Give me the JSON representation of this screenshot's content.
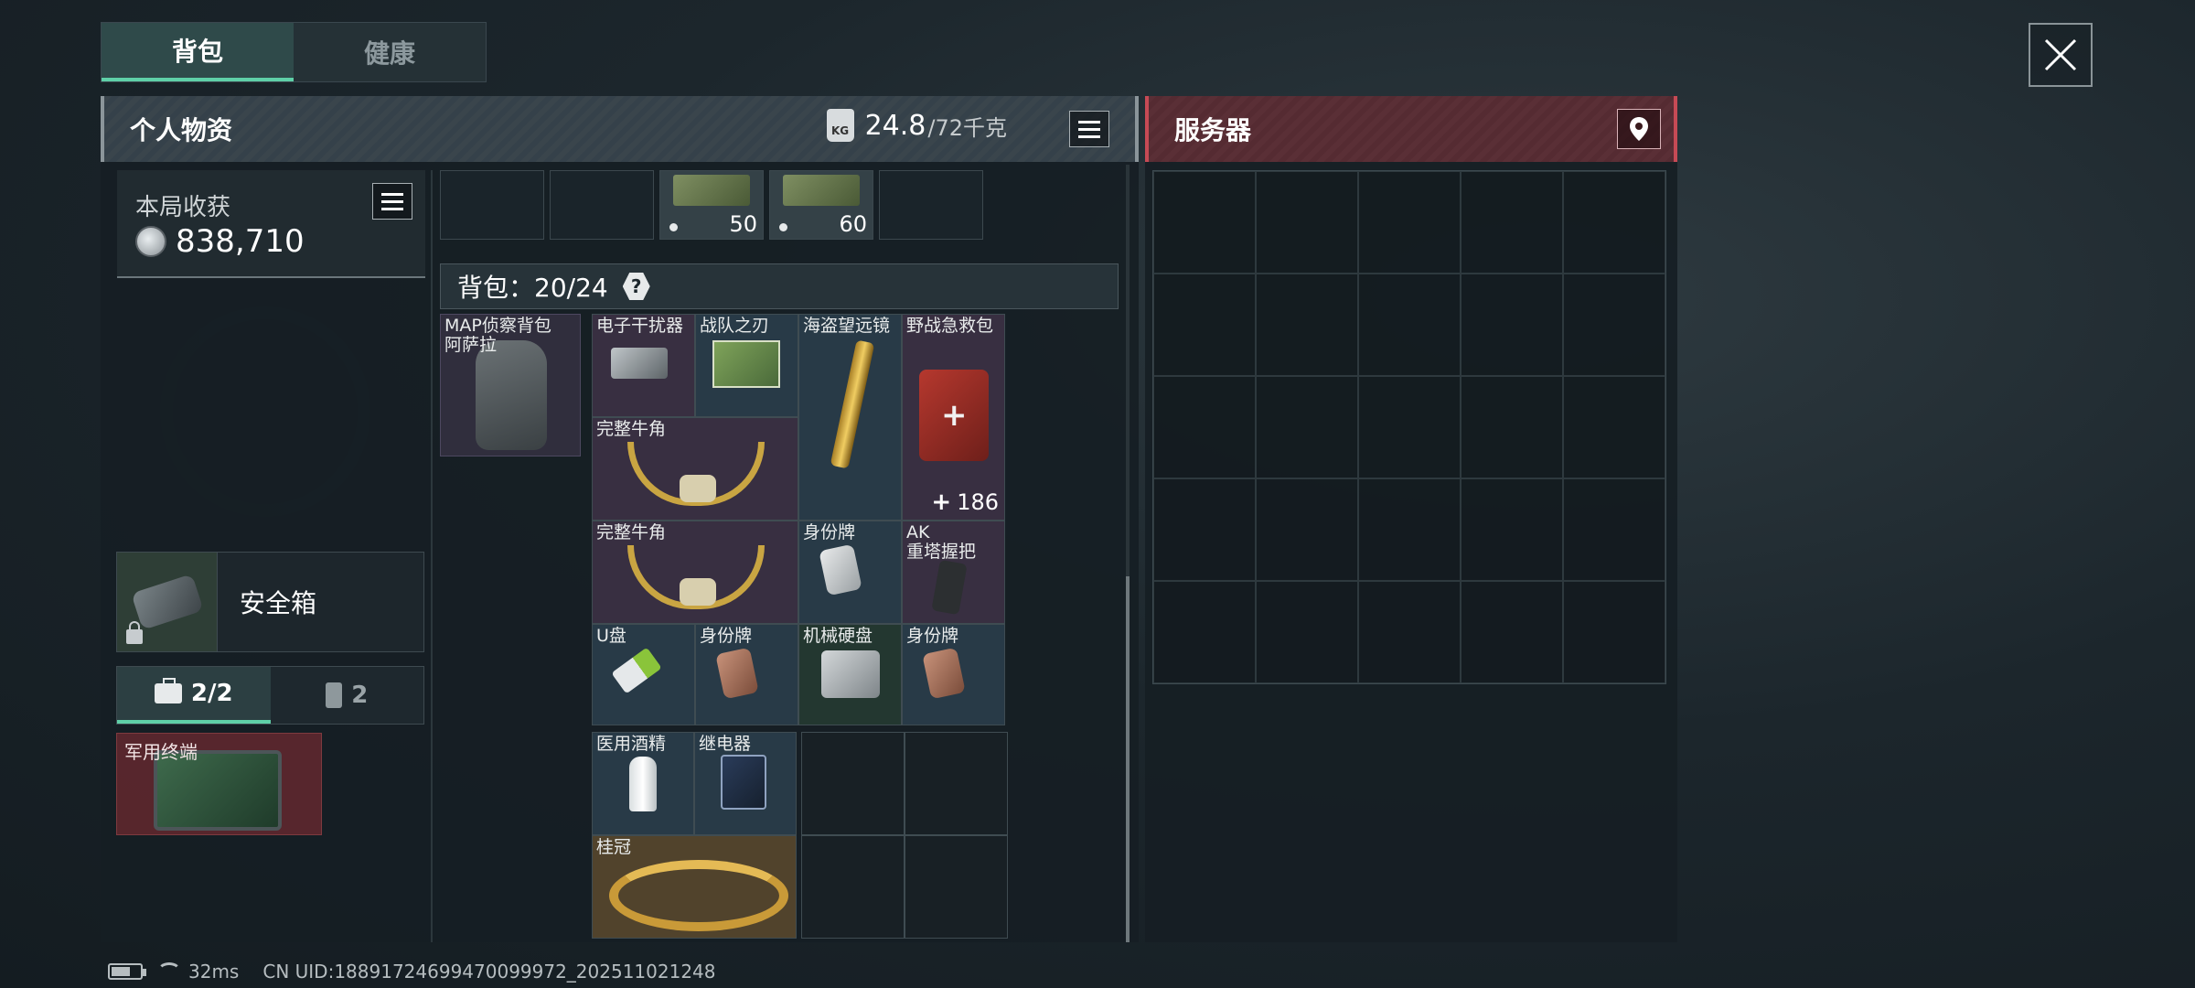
{
  "tabs": [
    "背包",
    "健康"
  ],
  "personal": {
    "title": "个人物资",
    "weight_value": "24.8",
    "weight_max": "/72千克",
    "kg_label": "KG"
  },
  "server": {
    "title": "服务器"
  },
  "harvest": {
    "label": "本局收获",
    "value": "838,710"
  },
  "safe": {
    "label": "安全箱"
  },
  "sub_tabs": {
    "toolbox": "2/2",
    "canister": "2"
  },
  "terminal": {
    "label": "军用终端"
  },
  "top_row": [
    {
      "count": "50"
    },
    {
      "count": "60"
    }
  ],
  "pack": {
    "label": "背包：20/24",
    "help": "?"
  },
  "backpack": {
    "name": "MAP侦察背包\n阿萨拉"
  },
  "items": {
    "jammer": "电子干扰器",
    "blade": "战队之刃",
    "scope": "海盗望远镜",
    "medkit": "野战急救包",
    "medkit_qty": "186",
    "horn1": "完整牛角",
    "horn2": "完整牛角",
    "tag1": "身份牌",
    "grip": "AK\n重塔握把",
    "usb": "U盘",
    "tag2": "身份牌",
    "hdd": "机械硬盘",
    "tag3": "身份牌",
    "alcohol": "医用酒精",
    "relay": "继电器",
    "laurel": "桂冠"
  },
  "status": {
    "ping": "32ms",
    "uid": "CN UID:18891724699470099972_202511021248"
  },
  "colors": {
    "accent": "#5fd0a8",
    "server_red": "#c64a55"
  }
}
